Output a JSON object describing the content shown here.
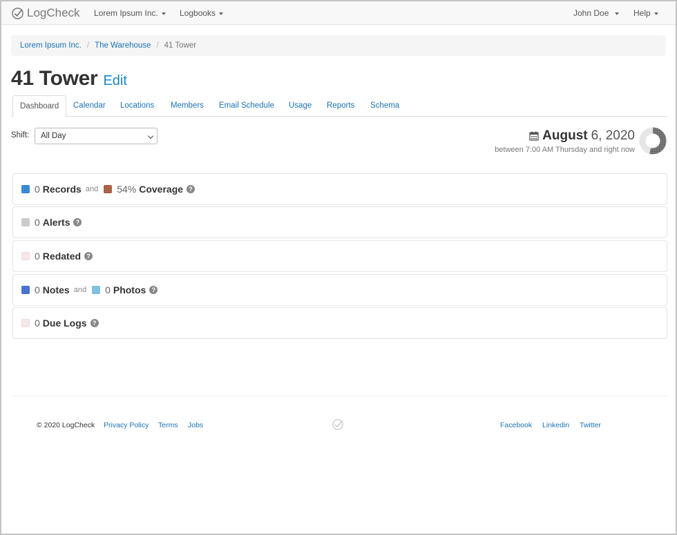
{
  "navbar": {
    "brand": "LogCheck",
    "org_menu": "Lorem Ipsum Inc.",
    "logbooks_menu": "Logbooks",
    "user_menu": "John Doe",
    "help_menu": "Help"
  },
  "breadcrumb": {
    "items": [
      "Lorem Ipsum Inc.",
      "The Warehouse"
    ],
    "current": "41 Tower"
  },
  "page": {
    "title": "41 Tower",
    "edit_label": "Edit"
  },
  "tabs": [
    {
      "label": "Dashboard",
      "active": true
    },
    {
      "label": "Calendar"
    },
    {
      "label": "Locations"
    },
    {
      "label": "Members"
    },
    {
      "label": "Email Schedule"
    },
    {
      "label": "Usage"
    },
    {
      "label": "Reports"
    },
    {
      "label": "Schema"
    }
  ],
  "shift": {
    "label": "Shift:",
    "selected": "All Day"
  },
  "date": {
    "month": "August",
    "day_year": "6, 2020",
    "subtitle": "between 7:00 AM Thursday and right now"
  },
  "panels": {
    "records": {
      "count": "0",
      "label": "Records",
      "and": "and",
      "coverage_value": "54%",
      "coverage_label": "Coverage",
      "color": "#3a8fd8"
    },
    "alerts": {
      "count": "0",
      "label": "Alerts",
      "color": "#cccccc"
    },
    "redated": {
      "count": "0",
      "label": "Redated",
      "color": "#f2e4e4"
    },
    "notes": {
      "count": "0",
      "label": "Notes",
      "and": "and",
      "photos_count": "0",
      "photos_label": "Photos",
      "color": "#4a78d8",
      "photos_color": "#7fc0e8"
    },
    "due_logs": {
      "count": "0",
      "label": "Due Logs",
      "color": "#f2e4e4"
    }
  },
  "footer": {
    "copyright": "© 2020 LogCheck",
    "privacy": "Privacy Policy",
    "terms": "Terms",
    "jobs": "Jobs",
    "facebook": "Facebook",
    "linkedin": "Linkedin",
    "twitter": "Twitter"
  }
}
